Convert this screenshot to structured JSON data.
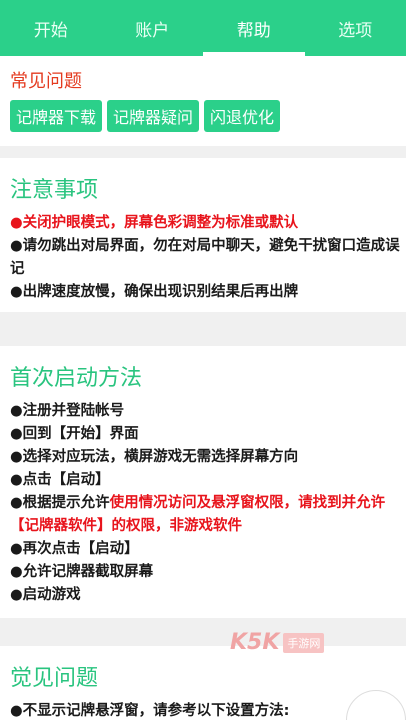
{
  "tabs": [
    {
      "label": "开始"
    },
    {
      "label": "账户"
    },
    {
      "label": "帮助"
    },
    {
      "label": "选项"
    }
  ],
  "faq": {
    "title": "常见问题",
    "buttons": [
      "记牌器下载",
      "记牌器疑问",
      "闪退优化"
    ]
  },
  "notice": {
    "title": "注意事项",
    "line1": "●关闭护眼模式，屏幕色彩调整为标准或默认",
    "line2": "●请勿跳出对局界面，勿在对局中聊天，避免干扰窗口造成误记",
    "line3": "●出牌速度放慢，确保出现识别结果后再出牌"
  },
  "first_start": {
    "title": "首次启动方法",
    "line1": "●注册并登陆帐号",
    "line2": "●回到【开始】界面",
    "line3": "●选择对应玩法，横屏游戏无需选择屏幕方向",
    "line4": "●点击【启动】",
    "line5_prefix": "●根据提示允许",
    "line5_red": "使用情况访问及悬浮窗权限，请找到并允许【记牌器软件】的权限，非游戏软件",
    "line6": "●再次点击【启动】",
    "line7": "●允许记牌器截取屏幕",
    "line8": "●启动游戏"
  },
  "faq2": {
    "title": "觉见问题",
    "line1": "●不显示记牌悬浮窗，请参考以下设置方法:"
  },
  "watermark": {
    "brand": "K5K",
    "sub": "手游网"
  },
  "colors": {
    "accent": "#2bd08a",
    "title_green": "#29c47f",
    "warn_red": "#e8141c",
    "faq_red": "#e43a1f"
  }
}
